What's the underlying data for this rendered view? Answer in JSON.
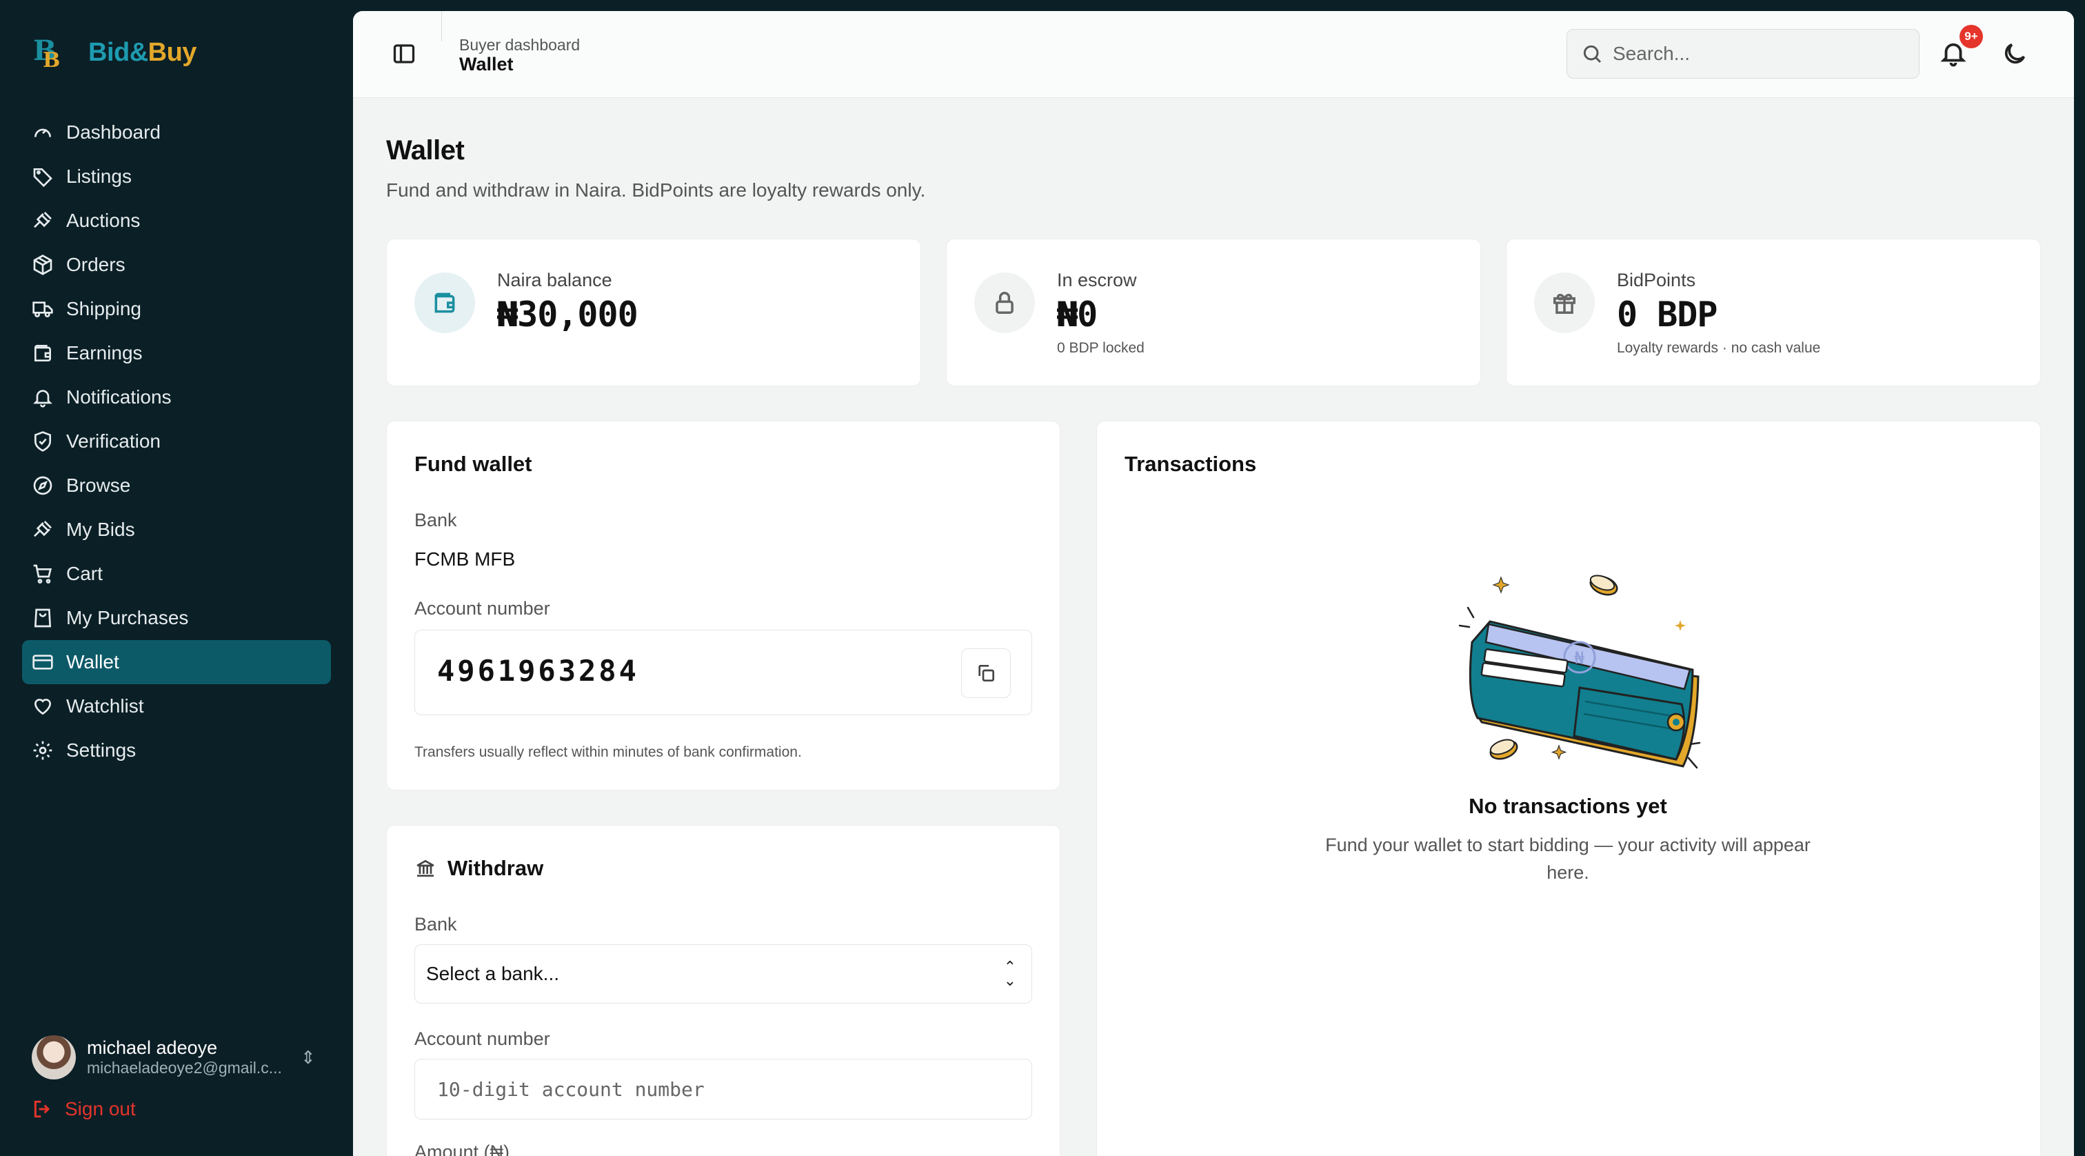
{
  "brand": {
    "name_part1": "Bid&",
    "name_part2": "Buy",
    "mark": "B"
  },
  "sidebar": {
    "items": [
      {
        "label": "Dashboard",
        "icon": "gauge-icon"
      },
      {
        "label": "Listings",
        "icon": "tag-icon"
      },
      {
        "label": "Auctions",
        "icon": "gavel-icon"
      },
      {
        "label": "Orders",
        "icon": "package-icon"
      },
      {
        "label": "Shipping",
        "icon": "truck-icon"
      },
      {
        "label": "Earnings",
        "icon": "wallet-icon"
      },
      {
        "label": "Notifications",
        "icon": "bell-icon"
      },
      {
        "label": "Verification",
        "icon": "shield-check-icon"
      },
      {
        "label": "Browse",
        "icon": "compass-icon"
      },
      {
        "label": "My Bids",
        "icon": "gavel-icon"
      },
      {
        "label": "Cart",
        "icon": "cart-icon"
      },
      {
        "label": "My Purchases",
        "icon": "shopping-bag-icon"
      },
      {
        "label": "Wallet",
        "icon": "credit-card-icon",
        "active": true
      },
      {
        "label": "Watchlist",
        "icon": "heart-icon"
      },
      {
        "label": "Settings",
        "icon": "gear-icon"
      }
    ],
    "user": {
      "name": "michael adeoye",
      "email": "michaeladeoye2@gmail.c..."
    },
    "sign_out": "Sign out"
  },
  "header": {
    "breadcrumb_parent": "Buyer dashboard",
    "breadcrumb_current": "Wallet",
    "search_placeholder": "Search...",
    "notification_badge": "9+"
  },
  "page": {
    "title": "Wallet",
    "subtitle": "Fund and withdraw in Naira. BidPoints are loyalty rewards only."
  },
  "stats": {
    "naira": {
      "label": "Naira balance",
      "value": "₦30,000"
    },
    "escrow": {
      "label": "In escrow",
      "value": "₦0",
      "note": "0 BDP locked"
    },
    "bidpoints": {
      "label": "BidPoints",
      "value": "0 BDP",
      "note": "Loyalty rewards · no cash value"
    }
  },
  "fund": {
    "title": "Fund wallet",
    "bank_label": "Bank",
    "bank_value": "FCMB MFB",
    "account_label": "Account number",
    "account_number": "4961963284",
    "hint": "Transfers usually reflect within minutes of bank confirmation."
  },
  "withdraw": {
    "title": "Withdraw",
    "bank_label": "Bank",
    "bank_selected": "Select a bank...",
    "account_label": "Account number",
    "account_placeholder": "10-digit account number",
    "amount_label": "Amount (₦)"
  },
  "transactions": {
    "title": "Transactions",
    "empty_title": "No transactions yet",
    "empty_text": "Fund your wallet to start bidding — your activity will appear here."
  },
  "colors": {
    "sidebar_bg": "#0b1f26",
    "active_item": "#0c5a68",
    "accent_teal": "#1b8fa0",
    "accent_gold": "#e3a72a",
    "danger": "#e5342b"
  }
}
